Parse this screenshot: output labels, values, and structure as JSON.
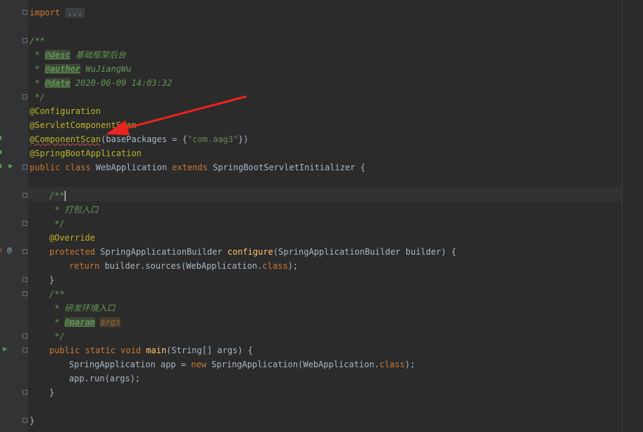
{
  "editor": {
    "lines": {
      "import_kw": "import",
      "import_fold": "...",
      "doc_open": "/**",
      "desc_star": " * ",
      "desc_tag": "@desc",
      "desc_text": " 基础框架后台",
      "author_star": " * ",
      "author_tag": "@author",
      "author_text": " WuJiangWu",
      "date_star": " * ",
      "date_tag": "@date",
      "date_text": " 2020-06-09 14:03:32",
      "doc_close": " */",
      "ann_configuration": "@Configuration",
      "ann_servlet_scan": "@ServletComponentScan",
      "ann_component_scan": "@ComponentScan",
      "component_scan_args_1": "(basePackages = {",
      "component_scan_string": "\"com.aag3\"",
      "component_scan_args_2": "})",
      "ann_spring_boot": "@SpringBootApplication",
      "class_kw1": "public class ",
      "class_name": "WebApplication ",
      "class_kw2": "extends ",
      "class_parent": "SpringBootServletInitializer {",
      "doc2_open": "/**",
      "doc2_text": " * 打包入口",
      "doc2_close": " */",
      "ann_override": "@Override",
      "configure_kw": "protected ",
      "configure_type": "SpringApplicationBuilder ",
      "configure_name": "configure",
      "configure_params": "(SpringApplicationBuilder builder) {",
      "return_kw": "return ",
      "return_expr": "builder.sources(WebApplication.",
      "return_class_kw": "class",
      "return_end": ");",
      "close_brace": "}",
      "doc3_open": "/**",
      "doc3_text": " * 研发环境入口",
      "doc3_star": " * ",
      "doc3_param_tag": "@param",
      "doc3_param_name": "args",
      "doc3_close": " */",
      "main_kw": "public static void ",
      "main_name": "main",
      "main_params": "(String[] args) {",
      "app_decl": "SpringApplication app = ",
      "app_new": "new ",
      "app_ctor": "SpringApplication(WebApplication.",
      "app_class_kw": "class",
      "app_end": ");",
      "run_stmt": "app.run(args);",
      "method_close": "}",
      "class_close": "}"
    }
  },
  "colors": {
    "background": "#2b2b2b",
    "gutter": "#313335",
    "keyword": "#cc7832",
    "annotation": "#bbb529",
    "string": "#6a8759",
    "doc_comment": "#629755",
    "method": "#ffc66d",
    "text": "#a9b7c6",
    "arrow": "#e8261f"
  },
  "icons": {
    "gutter": [
      "spring-bean-icon",
      "spring-bean-icon",
      "run-icon",
      "override-icon",
      "at-icon",
      "run-icon"
    ],
    "fold": [
      "fold-marker-icon"
    ]
  }
}
